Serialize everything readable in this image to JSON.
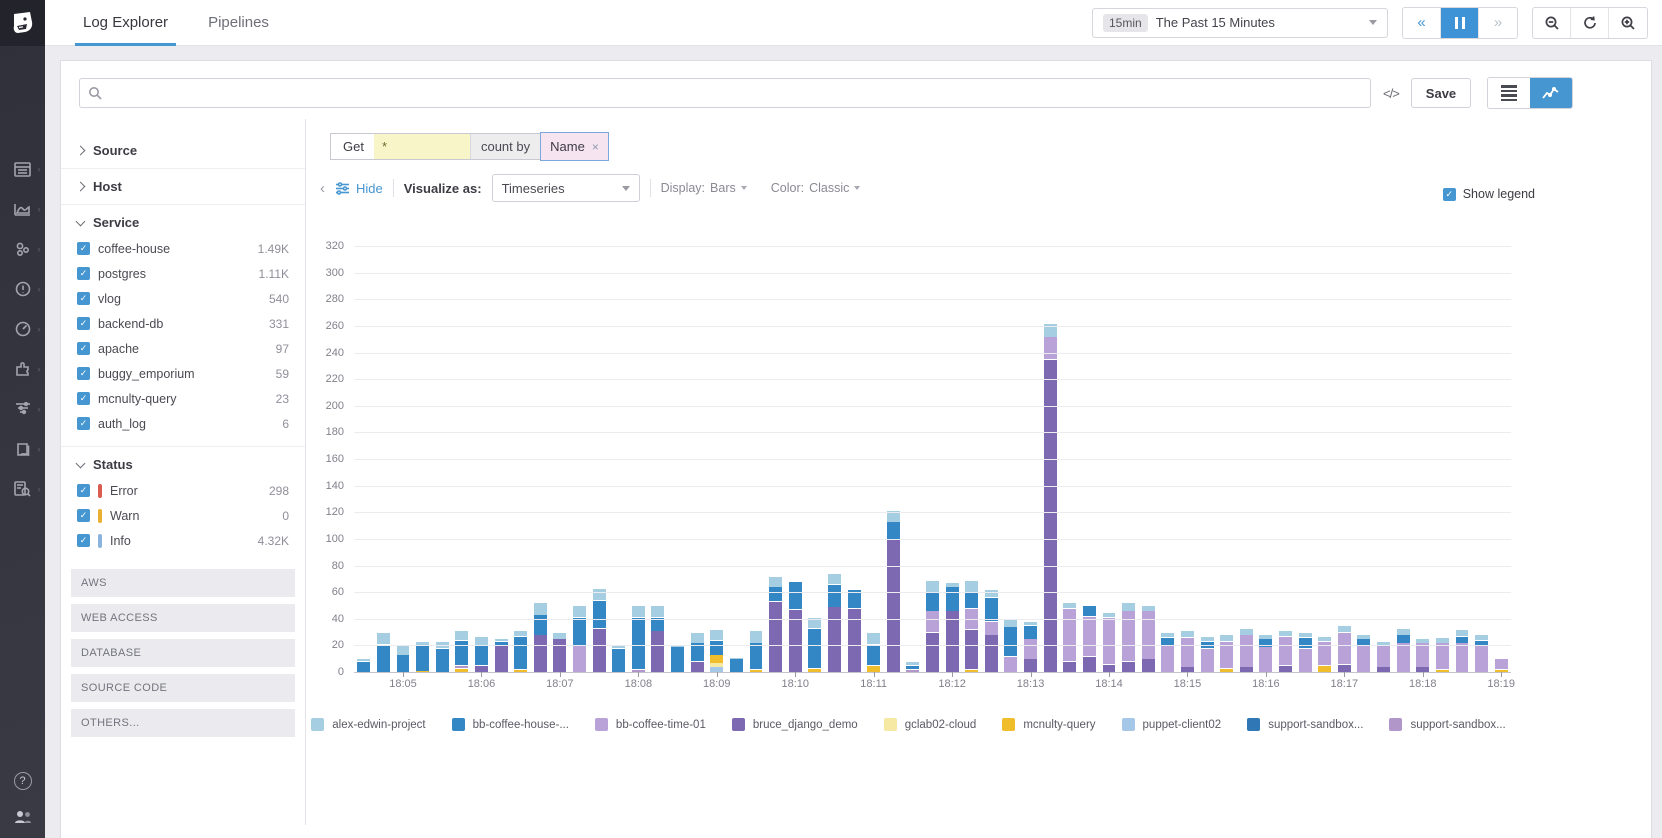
{
  "topbar": {
    "tabs": [
      {
        "label": "Log Explorer",
        "active": true
      },
      {
        "label": "Pipelines",
        "active": false
      }
    ],
    "time": {
      "badge": "15min",
      "label": "The Past 15 Minutes"
    }
  },
  "toolbar": {
    "code_label": "</>",
    "save_label": "Save"
  },
  "search": {
    "placeholder": "",
    "value": ""
  },
  "query": {
    "prefix": "Get",
    "star": "*",
    "count_by": "count by",
    "group_token": "Name",
    "remove": "×"
  },
  "controls": {
    "hide": "Hide",
    "visualize_label": "Visualize as:",
    "visualize_value": "Timeseries",
    "display_label": "Display:",
    "display_value": "Bars",
    "color_label": "Color:",
    "color_value": "Classic",
    "show_legend": "Show legend"
  },
  "ui": {
    "check": "✓"
  },
  "facets": {
    "source_label": "Source",
    "host_label": "Host",
    "service": {
      "label": "Service",
      "items": [
        {
          "label": "coffee-house",
          "count": "1.49K"
        },
        {
          "label": "postgres",
          "count": "1.11K"
        },
        {
          "label": "vlog",
          "count": "540"
        },
        {
          "label": "backend-db",
          "count": "331"
        },
        {
          "label": "apache",
          "count": "97"
        },
        {
          "label": "buggy_emporium",
          "count": "59"
        },
        {
          "label": "mcnulty-query",
          "count": "23"
        },
        {
          "label": "auth_log",
          "count": "6"
        }
      ]
    },
    "status": {
      "label": "Status",
      "items": [
        {
          "label": "Error",
          "count": "298",
          "color": "#d95c4e"
        },
        {
          "label": "Warn",
          "count": "0",
          "color": "#e8b02e"
        },
        {
          "label": "Info",
          "count": "4.32K",
          "color": "#8ab4dd"
        }
      ]
    },
    "groups": [
      "AWS",
      "WEB ACCESS",
      "DATABASE",
      "SOURCE CODE",
      "OTHERS..."
    ]
  },
  "chart_data": {
    "type": "bar",
    "stacked": true,
    "title": "",
    "xlabel": "",
    "ylabel": "",
    "ylim": [
      0,
      320
    ],
    "ytick_step": 20,
    "grid": true,
    "legend_position": "bottom",
    "xtick_labels": [
      "18:05",
      "18:06",
      "18:07",
      "18:08",
      "18:09",
      "18:10",
      "18:11",
      "18:12",
      "18:13",
      "18:14",
      "18:15",
      "18:16",
      "18:17",
      "18:18",
      "18:19"
    ],
    "series": [
      {
        "key": "ae",
        "name": "alex-edwin-project",
        "color": "#a5cee3"
      },
      {
        "key": "bch",
        "name": "bb-coffee-house-...",
        "color": "#3387c4"
      },
      {
        "key": "bct",
        "name": "bb-coffee-time-01",
        "color": "#b8a2d8"
      },
      {
        "key": "bdd",
        "name": "bruce_django_demo",
        "color": "#7d68b2"
      },
      {
        "key": "gc",
        "name": "gclab02-cloud",
        "color": "#f6e9a4"
      },
      {
        "key": "mq",
        "name": "mcnulty-query",
        "color": "#f0bd2d"
      },
      {
        "key": "pc",
        "name": "puppet-client02",
        "color": "#a6c8e8"
      },
      {
        "key": "ss1",
        "name": "support-sandbox...",
        "color": "#2f78b5"
      },
      {
        "key": "ss2",
        "name": "support-sandbox...",
        "color": "#b096c9"
      }
    ],
    "stack_order": [
      "pc",
      "gc",
      "mq",
      "ss2",
      "bdd",
      "bct",
      "ss1",
      "bch",
      "ae"
    ],
    "bars": [
      {
        "t": "18:04:30",
        "v": {
          "bch": 8,
          "ae": 2
        }
      },
      {
        "t": "18:04:45",
        "v": {
          "bch": 21,
          "ae": 9
        }
      },
      {
        "t": "18:05:00",
        "v": {
          "bch": 13,
          "ae": 8
        }
      },
      {
        "t": "18:05:15",
        "v": {
          "mq": 1,
          "bch": 19,
          "ae": 3
        }
      },
      {
        "t": "18:05:30",
        "v": {
          "bch": 18,
          "ae": 5
        }
      },
      {
        "t": "18:05:45",
        "v": {
          "mq": 3,
          "ss2": 2,
          "bch": 19,
          "ae": 7
        }
      },
      {
        "t": "18:06:00",
        "v": {
          "bdd": 5,
          "bch": 15,
          "ae": 7
        }
      },
      {
        "t": "18:06:15",
        "v": {
          "bdd": 20,
          "bch": 3,
          "ae": 2
        }
      },
      {
        "t": "18:06:30",
        "v": {
          "mq": 2,
          "bch": 25,
          "ae": 4
        }
      },
      {
        "t": "18:06:45",
        "v": {
          "bdd": 28,
          "bch": 15,
          "ae": 9
        }
      },
      {
        "t": "18:07:00",
        "v": {
          "bdd": 25,
          "ae": 5
        }
      },
      {
        "t": "18:07:15",
        "v": {
          "bct": 20,
          "bch": 21,
          "ae": 9
        }
      },
      {
        "t": "18:07:30",
        "v": {
          "bdd": 33,
          "bch": 21,
          "ae": 9
        }
      },
      {
        "t": "18:07:45",
        "v": {
          "bch": 18,
          "ae": 2
        }
      },
      {
        "t": "18:08:00",
        "v": {
          "ss2": 2,
          "bch": 39,
          "ae": 9
        }
      },
      {
        "t": "18:08:15",
        "v": {
          "bdd": 31,
          "bch": 10,
          "ae": 9
        }
      },
      {
        "t": "18:08:30",
        "v": {
          "bch": 19,
          "ae": 2
        }
      },
      {
        "t": "18:08:45",
        "v": {
          "bdd": 8,
          "bch": 14,
          "ae": 8
        }
      },
      {
        "t": "18:09:00",
        "v": {
          "pc": 4,
          "gc": 3,
          "mq": 6,
          "bch": 11,
          "ae": 8
        }
      },
      {
        "t": "18:09:15",
        "v": {
          "bch": 10,
          "ae": 1
        }
      },
      {
        "t": "18:09:30",
        "v": {
          "mq": 2,
          "bch": 20,
          "ae": 9
        }
      },
      {
        "t": "18:09:45",
        "v": {
          "bdd": 53,
          "bch": 11,
          "ae": 8
        }
      },
      {
        "t": "18:10:00",
        "v": {
          "bdd": 47,
          "bch": 21
        }
      },
      {
        "t": "18:10:15",
        "v": {
          "mq": 3,
          "bch": 30,
          "ae": 8
        }
      },
      {
        "t": "18:10:30",
        "v": {
          "bdd": 49,
          "bch": 17,
          "ae": 8
        }
      },
      {
        "t": "18:10:45",
        "v": {
          "bdd": 48,
          "bch": 14
        }
      },
      {
        "t": "18:11:00",
        "v": {
          "mq": 5,
          "bch": 16,
          "ae": 9
        }
      },
      {
        "t": "18:11:15",
        "v": {
          "bdd": 100,
          "bch": 13,
          "ae": 8
        }
      },
      {
        "t": "18:11:30",
        "v": {
          "ss2": 2,
          "bch": 3,
          "ae": 3
        }
      },
      {
        "t": "18:11:45",
        "v": {
          "bdd": 30,
          "bct": 16,
          "bch": 14,
          "ae": 9
        }
      },
      {
        "t": "18:12:00",
        "v": {
          "bdd": 46,
          "bch": 18,
          "ae": 3
        }
      },
      {
        "t": "18:12:15",
        "v": {
          "mq": 2,
          "bdd": 30,
          "bct": 16,
          "bch": 12,
          "ae": 9
        }
      },
      {
        "t": "18:12:30",
        "v": {
          "bdd": 28,
          "bct": 10,
          "bch": 18,
          "ae": 6
        }
      },
      {
        "t": "18:12:45",
        "v": {
          "bct": 12,
          "bch": 22,
          "ae": 6
        }
      },
      {
        "t": "18:13:00",
        "v": {
          "bdd": 10,
          "bct": 15,
          "bch": 10,
          "ae": 3
        }
      },
      {
        "t": "18:13:15",
        "v": {
          "bdd": 235,
          "bct": 17,
          "ae": 10
        }
      },
      {
        "t": "18:13:30",
        "v": {
          "bdd": 8,
          "bct": 40,
          "ae": 4
        }
      },
      {
        "t": "18:13:45",
        "v": {
          "bdd": 12,
          "bct": 30,
          "bch": 8
        }
      },
      {
        "t": "18:14:00",
        "v": {
          "bdd": 6,
          "bct": 35,
          "ae": 4
        }
      },
      {
        "t": "18:14:15",
        "v": {
          "bdd": 8,
          "bct": 38,
          "ae": 6
        }
      },
      {
        "t": "18:14:30",
        "v": {
          "bdd": 10,
          "bct": 36,
          "ae": 4
        }
      },
      {
        "t": "18:14:45",
        "v": {
          "bct": 20,
          "bch": 6,
          "ae": 4
        }
      },
      {
        "t": "18:15:00",
        "v": {
          "bdd": 4,
          "bct": 22,
          "ae": 5
        }
      },
      {
        "t": "18:15:15",
        "v": {
          "bct": 18,
          "bch": 5,
          "ae": 4
        }
      },
      {
        "t": "18:15:30",
        "v": {
          "mq": 3,
          "bct": 20,
          "ae": 5
        }
      },
      {
        "t": "18:15:45",
        "v": {
          "bdd": 4,
          "bct": 24,
          "ae": 5
        }
      },
      {
        "t": "18:16:00",
        "v": {
          "bct": 19,
          "bch": 6,
          "ae": 3
        }
      },
      {
        "t": "18:16:15",
        "v": {
          "bdd": 5,
          "bct": 22,
          "ae": 4
        }
      },
      {
        "t": "18:16:30",
        "v": {
          "bct": 18,
          "bch": 8,
          "ae": 4
        }
      },
      {
        "t": "18:16:45",
        "v": {
          "mq": 5,
          "bct": 18,
          "ae": 4
        }
      },
      {
        "t": "18:17:00",
        "v": {
          "bdd": 6,
          "bct": 24,
          "ae": 5
        }
      },
      {
        "t": "18:17:15",
        "v": {
          "bct": 20,
          "bch": 5,
          "ae": 3
        }
      },
      {
        "t": "18:17:30",
        "v": {
          "bdd": 4,
          "bct": 16,
          "ae": 3
        }
      },
      {
        "t": "18:17:45",
        "v": {
          "bct": 22,
          "bch": 6,
          "ae": 5
        }
      },
      {
        "t": "18:18:00",
        "v": {
          "bdd": 4,
          "bct": 18,
          "ae": 3
        }
      },
      {
        "t": "18:18:15",
        "v": {
          "mq": 2,
          "bct": 20,
          "ae": 4
        }
      },
      {
        "t": "18:18:30",
        "v": {
          "bct": 22,
          "bch": 5,
          "ae": 5
        }
      },
      {
        "t": "18:18:45",
        "v": {
          "bct": 20,
          "bch": 4,
          "ae": 4
        }
      },
      {
        "t": "18:19:00",
        "v": {
          "mq": 2,
          "bct": 8
        }
      }
    ]
  }
}
